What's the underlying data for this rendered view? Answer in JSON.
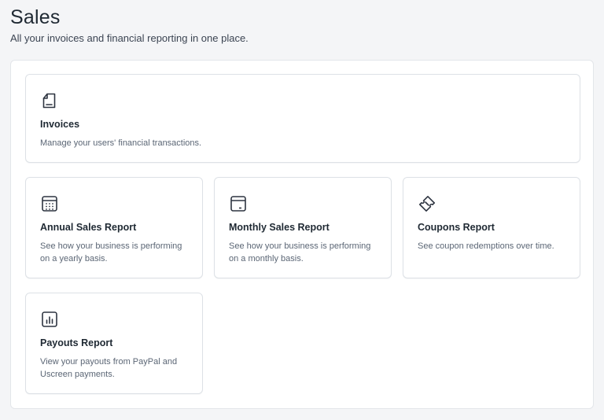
{
  "header": {
    "title": "Sales",
    "subtitle": "All your invoices and financial reporting in one place."
  },
  "cards": {
    "invoices": {
      "icon": "invoice-document-icon",
      "title": "Invoices",
      "description": "Manage your users' financial transactions."
    },
    "annual": {
      "icon": "calendar-grid-icon",
      "title": "Annual Sales Report",
      "description": "See how your business is performing on a yearly basis."
    },
    "monthly": {
      "icon": "calendar-month-icon",
      "title": "Monthly Sales Report",
      "description": "See how your business is performing on a monthly basis."
    },
    "coupons": {
      "icon": "coupon-ticket-icon",
      "title": "Coupons Report",
      "description": "See coupon redemptions over time."
    },
    "payouts": {
      "icon": "bar-chart-icon",
      "title": "Payouts Report",
      "description": "View your payouts from PayPal and Uscreen payments."
    }
  },
  "colors": {
    "background": "#f4f5f7",
    "panel": "#ffffff",
    "card_border": "#dde1e6",
    "text_primary": "#1f2933",
    "text_secondary": "#5b6675"
  }
}
